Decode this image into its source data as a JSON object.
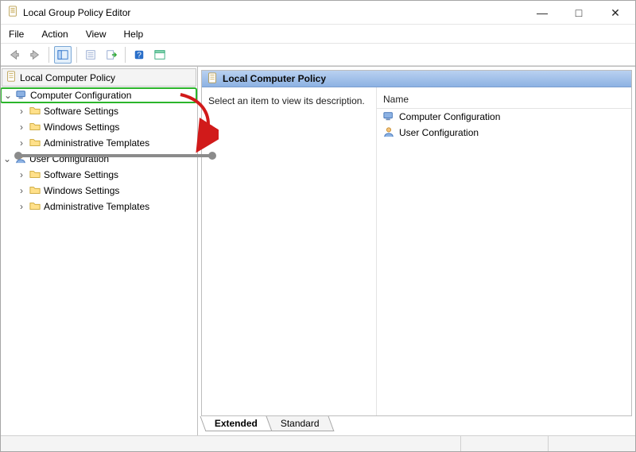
{
  "window": {
    "title": "Local Group Policy Editor"
  },
  "menu": {
    "file": "File",
    "action": "Action",
    "view": "View",
    "help": "Help"
  },
  "tree": {
    "root": "Local Computer Policy",
    "computer_config": "Computer Configuration",
    "user_config": "User Configuration",
    "software_settings": "Software Settings",
    "windows_settings": "Windows Settings",
    "admin_templates": "Administrative Templates"
  },
  "content": {
    "header": "Local Computer Policy",
    "description": "Select an item to view its description.",
    "name_column": "Name",
    "items": {
      "computer_config": "Computer Configuration",
      "user_config": "User Configuration"
    }
  },
  "tabs": {
    "extended": "Extended",
    "standard": "Standard"
  }
}
